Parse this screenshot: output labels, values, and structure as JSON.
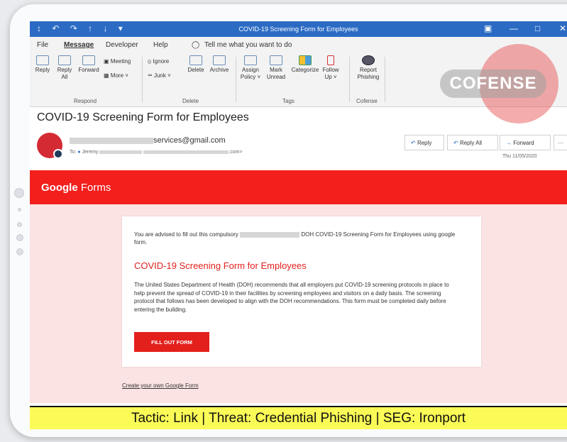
{
  "window": {
    "title": "COVID-19 Screening Form for Employees",
    "quick_access": "↕ ↶ ↷ ↑ ↓ ▾",
    "controls": [
      "▣",
      "—",
      "□",
      "✕"
    ]
  },
  "menu": {
    "items": [
      "File",
      "Message",
      "Developer",
      "Help"
    ],
    "tell_me": "Tell me what you want to do"
  },
  "ribbon": {
    "reply": "Reply",
    "reply_all": "Reply All",
    "forward": "Forward",
    "meeting": "Meeting",
    "more": "More ˅",
    "respond_group": "Respond",
    "ignore": "Ignore",
    "junk": "Junk ˅",
    "delete": "Delete",
    "archive": "Archive",
    "delete_group": "Delete",
    "assign_policy": "Assign Policy ˅",
    "mark_unread": "Mark Unread",
    "categorize": "Categorize",
    "follow_up": "Follow Up ˅",
    "tags_group": "Tags",
    "report_phishing": "Report Phishing",
    "cofense_group": "Cofense"
  },
  "watermark": {
    "brand": "COFENSE"
  },
  "message": {
    "subject": "COVID-19 Screening Form for Employees",
    "sender_suffix": "services@gmail.com",
    "to_label": "To:",
    "to_name": "Jeremy",
    "to_suffix": ".com>",
    "date": "Thu 11/05/2020",
    "reply": "Reply",
    "reply_all": "Reply All",
    "forward": "Forward",
    "more": "···"
  },
  "email_body": {
    "brand_google": "Google",
    "brand_forms": "Forms",
    "intro_a": "You are advised to fill out this compulsory",
    "intro_b": "DOH COVID-19 Screening Form for Employees using google form.",
    "form_title": "COVID-19 Screening Form for Employees",
    "form_text": "The United States Department of Health (DOH) recommends that all employers put COVID-19 screening protocols in place to help prevent the spread of COVID-19 in their facilities by screening employees and visitors on a daily basis. The screening protocol that follows has been developed to align with the DOH recommendations. This form must be completed daily before entering the building.",
    "cta": "FILL OUT FORM",
    "create_link": "Create your own Google Form"
  },
  "banner": {
    "text": "Tactic: Link | Threat: Credential Phishing | SEG: Ironport"
  },
  "colors": {
    "outlook_blue": "#2b6bc4",
    "google_red": "#f21f1c",
    "banner_yellow": "#fbfb57"
  }
}
